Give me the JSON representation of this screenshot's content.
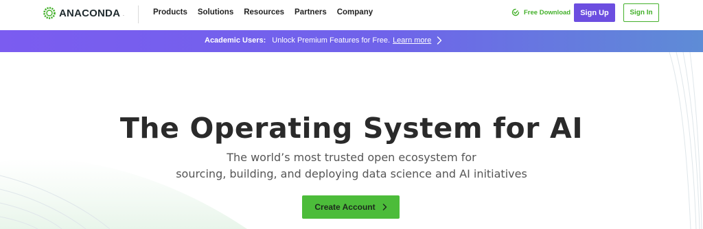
{
  "header": {
    "logo_text": "ANACONDA",
    "logo_tm": ".",
    "nav": [
      {
        "label": "Products"
      },
      {
        "label": "Solutions"
      },
      {
        "label": "Resources"
      },
      {
        "label": "Partners"
      },
      {
        "label": "Company"
      }
    ],
    "free_download_label": "Free Download",
    "signup_label": "Sign Up",
    "signin_label": "Sign In"
  },
  "banner": {
    "strong_text": "Academic Users:",
    "text": "Unlock Premium Features for Free.",
    "link_text": "Learn more"
  },
  "hero": {
    "title": "The Operating System for AI",
    "subtitle_line1": "The world’s most trusted open ecosystem for",
    "subtitle_line2": "sourcing, building, and deploying data science and AI initiatives",
    "cta_label": "Create Account"
  },
  "colors": {
    "brand_green": "#43b02a",
    "cta_green": "#4cbc3a",
    "signup_purple": "#6c4ee0",
    "banner_gradient_start": "#7b5cf0",
    "banner_gradient_end": "#5e8cd6"
  },
  "icons": [
    "anaconda-logo-icon",
    "download-check-icon",
    "chevron-right-icon"
  ]
}
